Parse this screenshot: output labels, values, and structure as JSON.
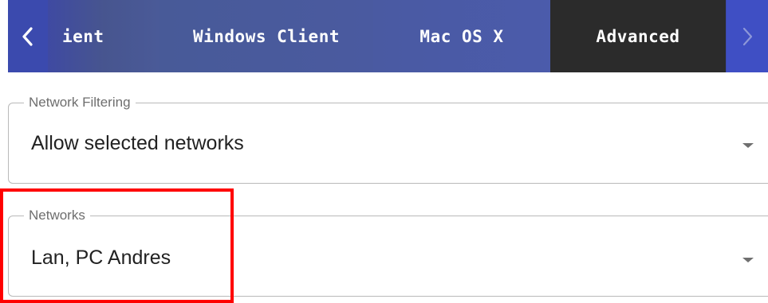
{
  "tabs": {
    "prev_icon": "chevron-left-icon",
    "next_icon": "chevron-right-icon",
    "items": [
      {
        "label": "ient"
      },
      {
        "label": "Windows Client"
      },
      {
        "label": "Mac OS X"
      },
      {
        "label": "Advanced",
        "selected": true
      }
    ],
    "colors": {
      "tab_background": "#3b4aae",
      "selected_background": "#2b2b2b",
      "text": "#ffffff"
    }
  },
  "form": {
    "network_filtering": {
      "label": "Network Filtering",
      "value": "Allow selected networks",
      "icon": "chevron-down-icon"
    },
    "networks": {
      "label": "Networks",
      "value": "Lan, PC Andres",
      "icon": "chevron-down-icon"
    }
  },
  "annotation": {
    "highlight_color": "#ff0000"
  }
}
